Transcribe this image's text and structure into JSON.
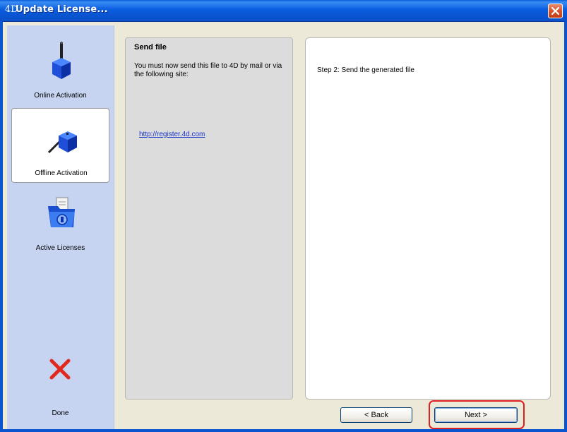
{
  "window": {
    "logo_text": "4D",
    "title": "Update License...",
    "close_icon": "close-icon"
  },
  "sidebar": {
    "items": [
      {
        "label": "Online Activation",
        "icon": "plunger-cube-icon",
        "selected": false
      },
      {
        "label": "Offline Activation",
        "icon": "tilted-plunger-cube-icon",
        "selected": true
      },
      {
        "label": "Active Licenses",
        "icon": "license-folder-icon",
        "selected": false
      },
      {
        "label": "Done",
        "icon": "red-x-icon",
        "selected": false
      }
    ]
  },
  "instructions": {
    "title": "Send file",
    "body": "You must now send this file to 4D  by mail or via the following site:",
    "link": "http://register.4d.com"
  },
  "step_panel": {
    "text": "Step 2: Send the generated file"
  },
  "buttons": {
    "back": "< Back",
    "next": "Next >"
  },
  "colors": {
    "titlebar": "#0a5fd8",
    "sidebar": "#c6d4f2",
    "link": "#1a33c8",
    "highlight": "#e02020"
  }
}
